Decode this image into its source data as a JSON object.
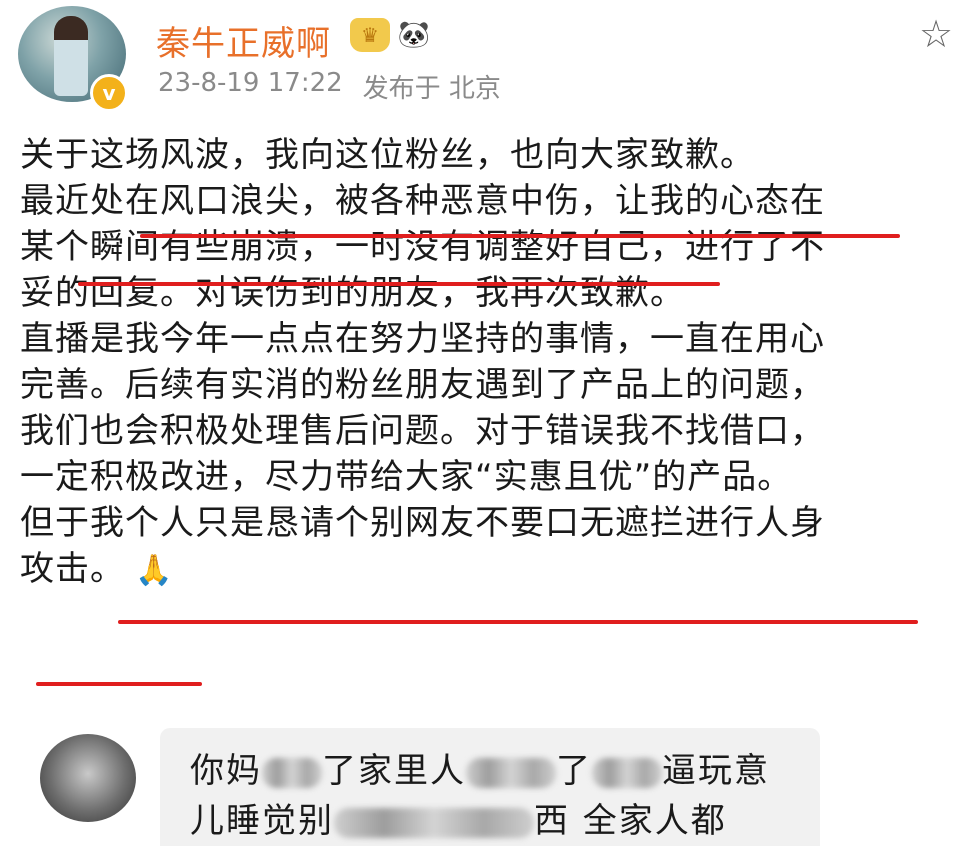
{
  "post": {
    "username": "秦牛正威啊",
    "badges": {
      "crown_glyph": "♛",
      "panda_glyph": "🐼"
    },
    "timestamp": "23-8-19 17:22",
    "published_at": "发布于 北京",
    "verified_glyph": "v",
    "star_glyph": "☆",
    "lines": [
      "关于这场风波，我向这位粉丝，也向大家致歉。",
      "最近处在风口浪尖，被各种恶意中伤，让我的心态在",
      "某个瞬间有些崩溃，一时没有调整好自己，进行了不",
      "妥的回复。对误伤到的朋友，我再次致歉。",
      "直播是我今年一点点在努力坚持的事情，一直在用心",
      "完善。后续有实消的粉丝朋友遇到了产品上的问题，",
      "我们也会积极处理售后问题。对于错误我不找借口，",
      "一定积极改进，尽力带给大家“实惠且优”的产品。",
      "但于我个人只是恳请个别网友不要口无遮拦进行人身",
      "攻击。"
    ],
    "pray_emoji": "🙏"
  },
  "comment": {
    "line1": {
      "part1": "你妈",
      "part2": "了家里人",
      "part3": "了",
      "part4": "逼玩意"
    },
    "line2": {
      "part1": "儿睡觉别",
      "part2": "西 全家人都"
    }
  },
  "colors": {
    "username": "#e8702a",
    "meta": "#8a8a8a",
    "underline": "#e01e1e",
    "comment_bg": "#f1f1f1"
  }
}
